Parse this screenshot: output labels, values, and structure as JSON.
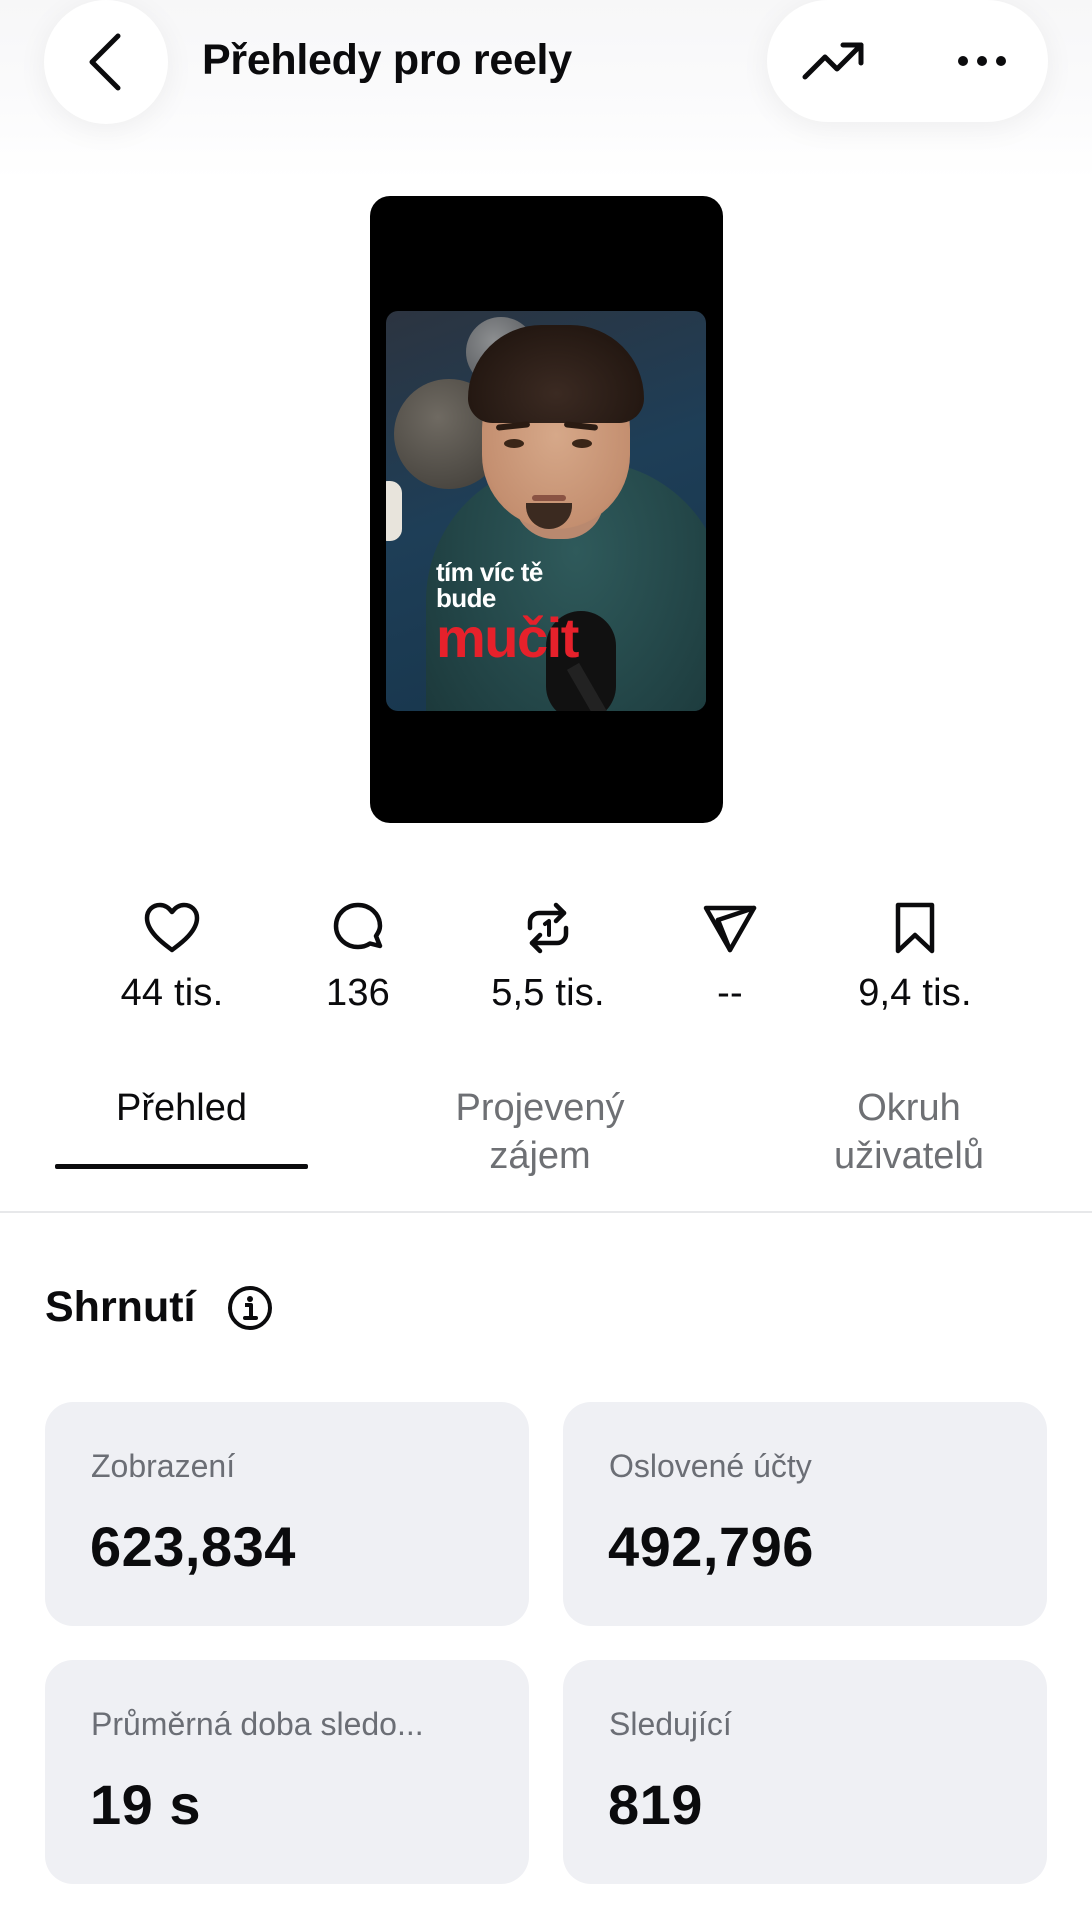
{
  "header": {
    "title": "Přehledy pro reely"
  },
  "reel": {
    "overlay_line1": "tím víc tě",
    "overlay_line2": "bude",
    "overlay_line3": "mučit"
  },
  "stats": [
    {
      "icon": "heart-icon",
      "value": "44 tis."
    },
    {
      "icon": "comment-icon",
      "value": "136"
    },
    {
      "icon": "repost-icon",
      "value": "5,5 tis."
    },
    {
      "icon": "share-icon",
      "value": "--"
    },
    {
      "icon": "bookmark-icon",
      "value": "9,4 tis."
    }
  ],
  "tabs": [
    {
      "label": "Přehled",
      "active": true
    },
    {
      "label": "Projevený\nzájem",
      "active": false
    },
    {
      "label": "Okruh\nuživatelů",
      "active": false
    }
  ],
  "summary": {
    "title": "Shrnutí",
    "cards": [
      {
        "label": "Zobrazení",
        "value": "623,834"
      },
      {
        "label": "Oslovené účty",
        "value": "492,796"
      },
      {
        "label": "Průměrná doba sledo...",
        "value": "19 s"
      },
      {
        "label": "Sledující",
        "value": "819"
      }
    ]
  },
  "colors": {
    "accent_text": "#0b0b0d",
    "muted_text": "#6e7074",
    "card_bg": "#eff0f4",
    "overlay_red": "#e6212b"
  }
}
